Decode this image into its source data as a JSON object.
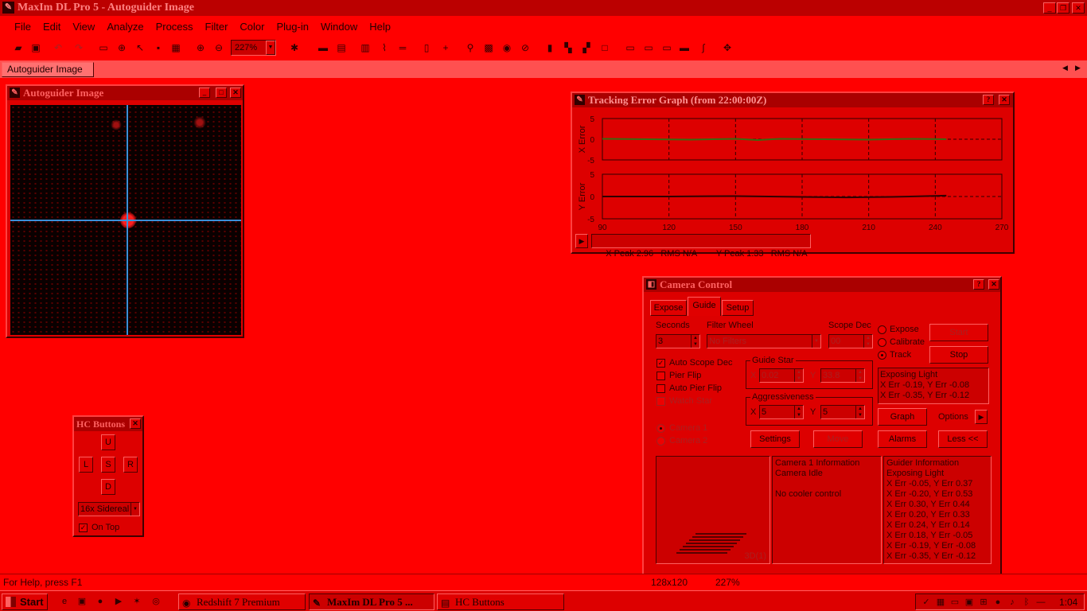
{
  "window": {
    "title": "MaxIm DL Pro 5 - Autoguider Image"
  },
  "menu": [
    "File",
    "Edit",
    "View",
    "Analyze",
    "Process",
    "Filter",
    "Color",
    "Plug-in",
    "Window",
    "Help"
  ],
  "toolbar": {
    "zoom": "227%"
  },
  "tabs": {
    "active": "Autoguider Image"
  },
  "autoguider": {
    "title": "Autoguider Image"
  },
  "tracking": {
    "title": "Tracking Error Graph (from 22:00:00Z)",
    "x_axis_label": "X Error",
    "y_axis_label": "Y Error",
    "status": "X Peak 2.96   RMS N/A        Y Peak 1.33   RMS N/A"
  },
  "chart_data": [
    {
      "type": "line",
      "ylabel": "X Error",
      "ylim": [
        -5,
        5
      ],
      "xlim": [
        90,
        270
      ],
      "yticks": [
        "5",
        "0",
        "-5"
      ],
      "series": [
        {
          "x": [
            90,
            110,
            130,
            150,
            160,
            170,
            190,
            210,
            230,
            245
          ],
          "values": [
            0.1,
            0,
            -0.1,
            0.1,
            -0.2,
            0.1,
            0,
            -0.1,
            0.1,
            0
          ]
        }
      ]
    },
    {
      "type": "line",
      "ylabel": "Y Error",
      "ylim": [
        -5,
        5
      ],
      "xlim": [
        90,
        270
      ],
      "xticks": [
        "90",
        "120",
        "150",
        "180",
        "210",
        "240",
        "270"
      ],
      "yticks": [
        "5",
        "0",
        "-5"
      ],
      "series": [
        {
          "x": [
            90,
            120,
            150,
            180,
            200,
            220,
            245
          ],
          "values": [
            0,
            0,
            0.1,
            -0.1,
            -0.2,
            -0.1,
            0.2
          ]
        }
      ]
    }
  ],
  "camera": {
    "title": "Camera Control",
    "tabs": [
      "Expose",
      "Guide",
      "Setup"
    ],
    "seconds_label": "Seconds",
    "seconds_value": "3",
    "filter_label": "Filter Wheel",
    "filter_value": "No Filters",
    "scope_label": "Scope Dec",
    "scope_value": "00",
    "radio_expose": "Expose",
    "radio_calibrate": "Calibrate",
    "radio_track": "Track",
    "start": "Start",
    "stop": "Stop",
    "auto_scope": "Auto Scope Dec",
    "pier_flip": "Pier Flip",
    "auto_pier": "Auto Pier Flip",
    "watch_star": "Watch Star",
    "guide_star_label": "Guide Star",
    "gs_x": "0.02",
    "gs_y": "33.8",
    "aggr_label": "Aggressiveness",
    "ag_x": "5",
    "ag_y": "5",
    "camera1": "Camera 1",
    "camera2": "Camera 2",
    "status_lines": [
      "Exposing Light",
      "X Err -0.19, Y Err -0.08",
      "X Err -0.35, Y Err -0.12"
    ],
    "graph": "Graph",
    "options": "Options",
    "settings": "Settings",
    "move": "Move",
    "alarms": "Alarms",
    "less": "Less <<",
    "cam_info": [
      "Camera 1 Information",
      "Camera Idle",
      "",
      "No cooler control"
    ],
    "guider_info": [
      "Guider Information",
      "Exposing Light",
      "X Err -0.05, Y Err 0.37",
      "X Err -0.20, Y Err 0.53",
      "X Err 0.30, Y Err 0.44",
      "X Err 0.20, Y Err 0.33",
      "X Err 0.24, Y Err 0.14",
      "X Err 0.18, Y Err -0.05",
      "X Err -0.19, Y Err -0.08",
      "X Err -0.35, Y Err -0.12"
    ],
    "thumb_label": "3D(1)"
  },
  "hc": {
    "title": "HC Buttons",
    "u": "U",
    "l": "L",
    "s": "S",
    "r": "R",
    "d": "D",
    "rate": "16x Sidereal",
    "ontop": "On Top"
  },
  "status": {
    "help": "For Help, press F1",
    "size": "128x120",
    "zoom": "227%"
  },
  "taskbar": {
    "start": "Start",
    "t1": "Redshift 7 Premium",
    "t2": "MaxIm DL Pro 5 ...",
    "t3": "HC Buttons",
    "clock": "1:04"
  }
}
